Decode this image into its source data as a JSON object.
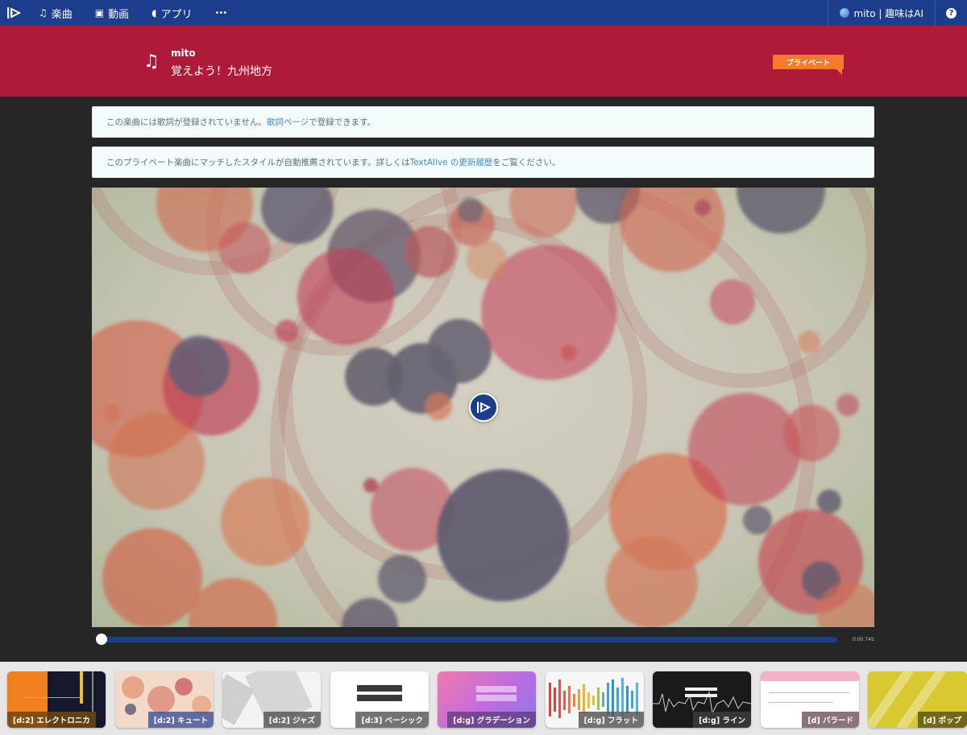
{
  "nav": {
    "items": [
      {
        "icon": "music-note-icon",
        "label": "楽曲"
      },
      {
        "icon": "video-icon",
        "label": "動画"
      },
      {
        "icon": "mouse-icon",
        "label": "アプリ"
      },
      {
        "icon": "more-icon",
        "label": "•••"
      }
    ],
    "user_label": "mito | 趣味はAI",
    "help_label": "?"
  },
  "song": {
    "artist": "mito",
    "title": "覚えよう！九州地方",
    "badge": "プライベート"
  },
  "notices": {
    "lyrics": {
      "text_before": "この楽曲には歌詞が登録されていません。",
      "link": "歌詞ページ",
      "text_after": "で登録できます。"
    },
    "style": {
      "text_before": "このプライベート楽曲にマッチしたスタイルが自動推薦されています。詳しくは ",
      "link": "TextAlive の更新履歴",
      "text_after": " をご覧ください。"
    }
  },
  "player": {
    "time": "0:00.745",
    "progress": 0.0
  },
  "styles": [
    {
      "label": "[d:2] エレクトロニカ"
    },
    {
      "label": "[d:2] キュート"
    },
    {
      "label": "[d:2] ジャズ"
    },
    {
      "label": "[d:3] ベーシック"
    },
    {
      "label": "[d:g] グラデーション"
    },
    {
      "label": "[d:g] フラット"
    },
    {
      "label": "[d:g] ライン"
    },
    {
      "label": "[d] バラード"
    },
    {
      "label": "[d] ポップ"
    }
  ],
  "colors": {
    "nav": "#1c3c8c",
    "banner": "#b01a3a",
    "badge": "#f47a2e"
  }
}
